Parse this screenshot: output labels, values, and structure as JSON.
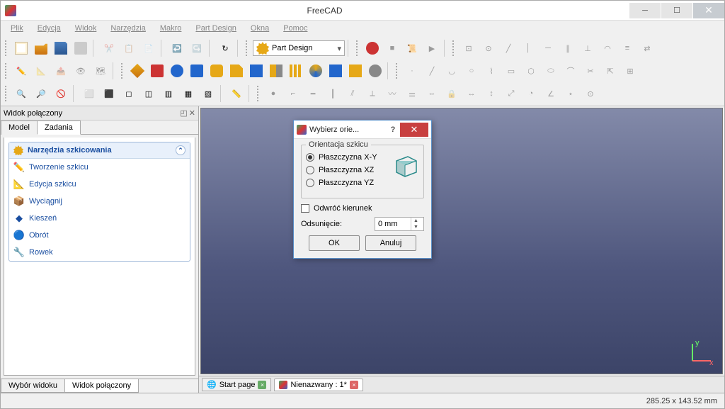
{
  "app": {
    "title": "FreeCAD"
  },
  "menu": [
    "Plik",
    "Edycja",
    "Widok",
    "Narzędzia",
    "Makro",
    "Part Design",
    "Okna",
    "Pomoc"
  ],
  "workbench": {
    "selected": "Part Design"
  },
  "dock": {
    "title": "Widok połączony",
    "tabs": {
      "model": "Model",
      "tasks": "Zadania"
    },
    "task_group": {
      "title": "Narzędzia szkicowania",
      "items": [
        {
          "label": "Tworzenie szkicu",
          "icon": "✏️",
          "name": "create-sketch"
        },
        {
          "label": "Edycja szkicu",
          "icon": "📐",
          "name": "edit-sketch"
        },
        {
          "label": "Wyciągnij",
          "icon": "📦",
          "name": "pad"
        },
        {
          "label": "Kieszeń",
          "icon": "◆",
          "name": "pocket"
        },
        {
          "label": "Obrót",
          "icon": "🔵",
          "name": "revolve"
        },
        {
          "label": "Rowek",
          "icon": "🔧",
          "name": "groove"
        }
      ]
    },
    "footer_tabs": {
      "view_select": "Wybór widoku",
      "combo": "Widok połączony"
    }
  },
  "doc_tabs": {
    "start": "Start page",
    "unnamed": "Nienazwany : 1*"
  },
  "status": {
    "coords": "285.25 x 143.52  mm"
  },
  "dialog": {
    "title": "Wybierz orie...",
    "group_title": "Orientacja szkicu",
    "options": {
      "xy": "Płaszczyzna X-Y",
      "xz": "Płaszczyzna XZ",
      "yz": "Płaszczyzna YZ"
    },
    "reverse": "Odwróć kierunek",
    "offset_label": "Odsunięcie:",
    "offset_value": "0 mm",
    "ok": "OK",
    "cancel": "Anuluj"
  }
}
